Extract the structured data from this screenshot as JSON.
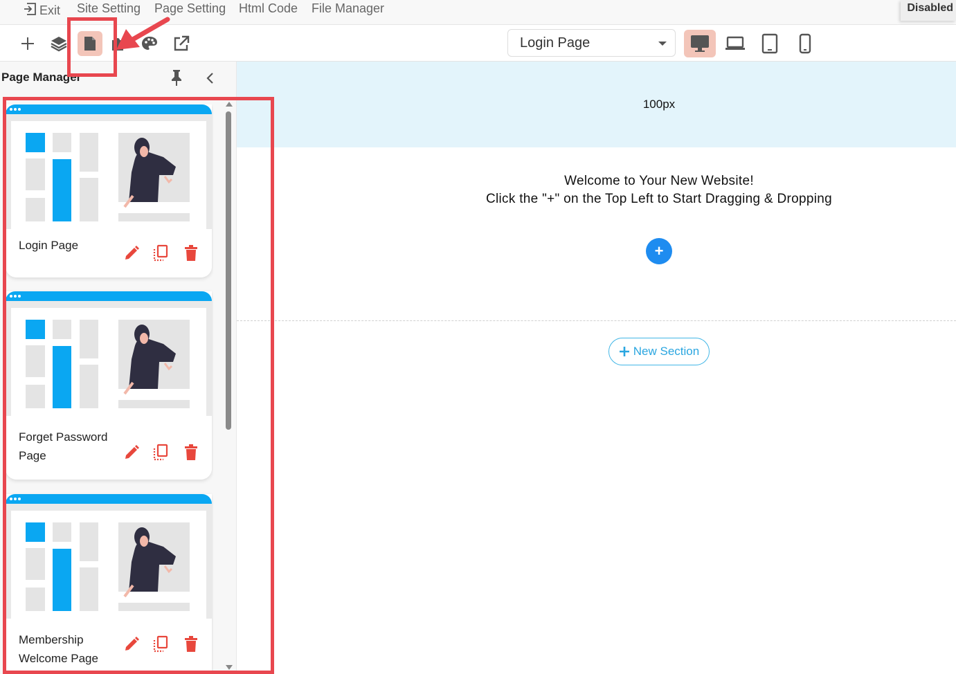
{
  "menu": {
    "exit": "Exit",
    "site_setting": "Site Setting",
    "page_setting": "Page Setting",
    "html_code": "Html Code",
    "file_manager": "File Manager",
    "status": "Disabled"
  },
  "toolbar": {
    "page_select_value": "Login Page",
    "tools": [
      "plus-icon",
      "layers-icon",
      "page-icon",
      "puzzle-icon",
      "palette-icon",
      "external-link-icon"
    ],
    "devices": [
      "desktop-icon",
      "laptop-icon",
      "tablet-icon",
      "mobile-icon"
    ],
    "active_tool": "page-icon",
    "active_device": "desktop-icon"
  },
  "sidebar": {
    "title": "Page Manager",
    "pages": [
      {
        "name": "Login Page"
      },
      {
        "name": "Forget Password Page"
      },
      {
        "name": "Membership Welcome Page"
      }
    ]
  },
  "canvas": {
    "spacer_label": "100px",
    "welcome_line1": "Welcome to Your New Website!",
    "welcome_line2": "Click the \"+\" on the Top Left to Start Dragging & Dropping",
    "add_symbol": "+",
    "new_section_label": "New Section"
  },
  "colors": {
    "accent_blue": "#0aa7f2",
    "action_red": "#e8473c",
    "highlight_red": "#e8474f",
    "active_bg": "#f3c5b9"
  }
}
